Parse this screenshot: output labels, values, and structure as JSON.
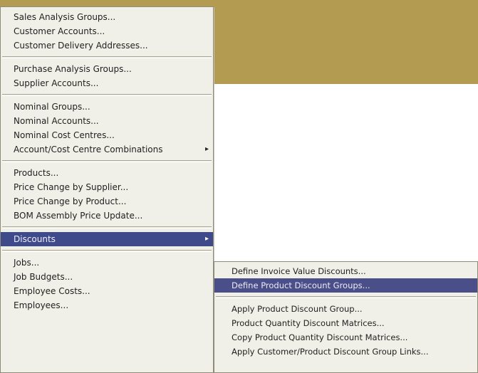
{
  "main_menu": {
    "groups": [
      [
        {
          "label": "Sales Analysis Groups..."
        },
        {
          "label": "Customer Accounts..."
        },
        {
          "label": "Customer Delivery Addresses..."
        }
      ],
      [
        {
          "label": "Purchase Analysis Groups..."
        },
        {
          "label": "Supplier Accounts..."
        }
      ],
      [
        {
          "label": "Nominal Groups..."
        },
        {
          "label": "Nominal Accounts..."
        },
        {
          "label": "Nominal Cost Centres..."
        },
        {
          "label": "Account/Cost Centre Combinations"
        }
      ],
      [
        {
          "label": "Products..."
        },
        {
          "label": "Price Change by Supplier..."
        },
        {
          "label": "Price Change by Product..."
        },
        {
          "label": "BOM Assembly Price Update..."
        }
      ],
      [
        {
          "label": "Discounts"
        }
      ],
      [
        {
          "label": "Jobs..."
        },
        {
          "label": "Job Budgets..."
        },
        {
          "label": "Employee Costs..."
        },
        {
          "label": "Employees..."
        }
      ]
    ]
  },
  "sub_menu": {
    "groups": [
      [
        {
          "label": "Define Invoice Value Discounts..."
        },
        {
          "label": "Define Product Discount Groups..."
        }
      ],
      [
        {
          "label": "Apply Product Discount Group..."
        },
        {
          "label": "Product Quantity Discount Matrices..."
        },
        {
          "label": "Copy Product Quantity Discount Matrices..."
        },
        {
          "label": "Apply Customer/Product Discount Group Links..."
        }
      ]
    ]
  },
  "icons": {
    "submenu_arrow": "▸"
  },
  "colors": {
    "backdrop": "#b39b52",
    "menu_bg": "#f1f0e8",
    "highlight": "#3f4a8a",
    "sub_highlight": "#4b4f89"
  }
}
